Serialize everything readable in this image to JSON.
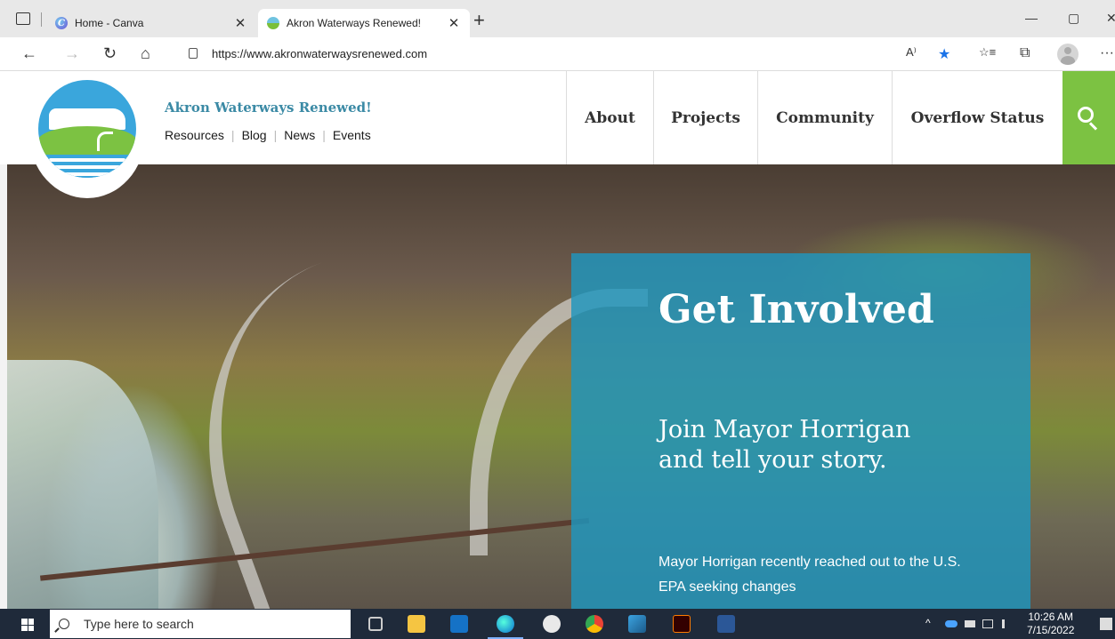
{
  "browser": {
    "tabs": [
      {
        "title": "Home - Canva",
        "close": "✕"
      },
      {
        "title": "Akron Waterways Renewed!",
        "close": "✕"
      }
    ],
    "new_tab": "+",
    "url": "https://www.akronwaterwaysrenewed.com",
    "window_controls": {
      "minimize": "—",
      "restore": "▢",
      "close": "✕"
    },
    "nav": {
      "back": "←",
      "forward": "→",
      "refresh": "↻",
      "home": "⌂"
    },
    "toolbar_icons": {
      "read_aloud": "A⁾",
      "favorite": "★",
      "favorites_bar": "☆≡",
      "collections": "⧉",
      "more": "···"
    }
  },
  "site": {
    "name": "Akron Waterways Renewed!",
    "util_links": [
      "Resources",
      "Blog",
      "News",
      "Events"
    ],
    "nav": [
      "About",
      "Projects",
      "Community",
      "Overflow Status"
    ],
    "brand_green": "#7cc242",
    "brand_blue": "#3b8aa5",
    "hero": {
      "heading": "Get Involved",
      "subheading": "Join Mayor Horrigan and tell your story.",
      "body": "Mayor Horrigan recently reached out to the U.S. EPA seeking changes"
    }
  },
  "taskbar": {
    "search_placeholder": "Type here to search",
    "tray": "^",
    "time": "10:26 AM",
    "date": "7/15/2022"
  }
}
